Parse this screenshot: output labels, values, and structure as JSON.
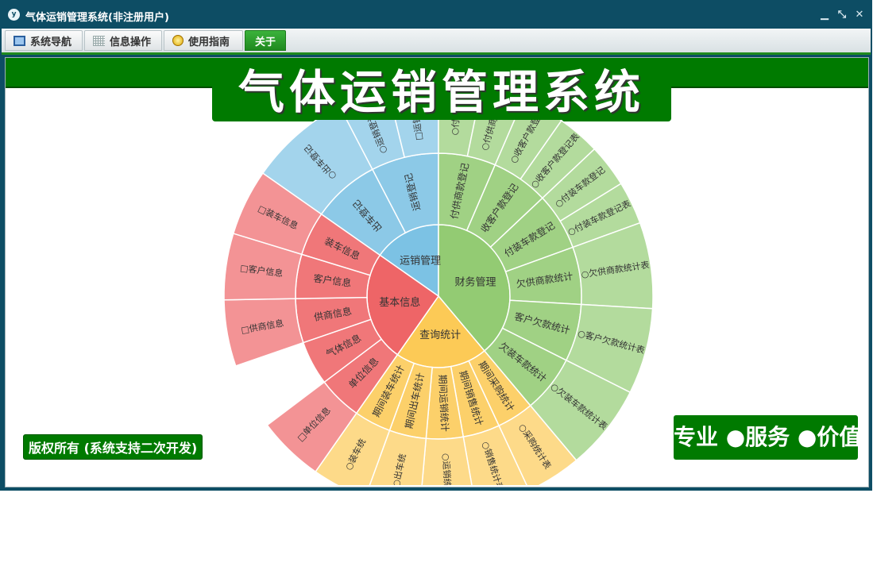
{
  "window": {
    "title": "气体运销管理系统(非注册用户)",
    "icon_name": "app-logo-icon"
  },
  "menubar": {
    "items": [
      {
        "label": "系统导航",
        "icon": "monitor-icon"
      },
      {
        "label": "信息操作",
        "icon": "grid-icon"
      },
      {
        "label": "使用指南",
        "icon": "help-disc-icon"
      },
      {
        "label": "关于",
        "icon": ""
      }
    ]
  },
  "header_banner": "气体运销管理系统",
  "copyright": "版权所有 (系统支持二次开发)",
  "slogan": "专业 ●服务 ●价值",
  "colors": {
    "window_frame": "#0d4d64",
    "banner_green": "#007a00",
    "finance": "#93cb73",
    "transport": "#7cc2e4",
    "basic": "#ee6567",
    "query": "#fcca56"
  },
  "sunburst": {
    "center_label": "",
    "sectors": [
      {
        "name": "运销管理",
        "color": "#7cc2e4",
        "children": [
          {
            "name": "出车登记",
            "children": [
              {
                "name": "○出车登记"
              }
            ]
          },
          {
            "name": "运销登记",
            "children": [
              {
                "name": "○运销登记表"
              },
              {
                "name": "□运销登记"
              }
            ]
          }
        ]
      },
      {
        "name": "财务管理",
        "color": "#93cb73",
        "children": [
          {
            "name": "付供商款登记",
            "children": [
              {
                "name": "○付供商"
              },
              {
                "name": "○付供商款记"
              }
            ]
          },
          {
            "name": "收客户款登记",
            "children": [
              {
                "name": "○收客户款登"
              },
              {
                "name": "○收客户款登记表"
              }
            ]
          },
          {
            "name": "付装车款登记",
            "children": [
              {
                "name": "○付装车款登记"
              },
              {
                "name": "○付装车款登记表"
              }
            ]
          },
          {
            "name": "欠供商款统计",
            "children": [
              {
                "name": "○欠供商款统计表"
              }
            ]
          },
          {
            "name": "客户欠款统计",
            "children": [
              {
                "name": "○客户欠款统计表"
              }
            ]
          },
          {
            "name": "欠装车款统计",
            "children": [
              {
                "name": "○欠装车款统计表"
              }
            ]
          }
        ]
      },
      {
        "name": "查询统计",
        "color": "#fcca56",
        "children": [
          {
            "name": "期间采购统计",
            "children": [
              {
                "name": "○采购统计表"
              }
            ]
          },
          {
            "name": "期间销售统计",
            "children": [
              {
                "name": "○销售统计表"
              }
            ]
          },
          {
            "name": "期间运销统计",
            "children": [
              {
                "name": "○运销统计"
              }
            ]
          },
          {
            "name": "期间出车统计",
            "children": [
              {
                "name": "○出车统"
              }
            ]
          },
          {
            "name": "期间装车统计",
            "children": [
              {
                "name": "○装车统"
              }
            ]
          }
        ]
      },
      {
        "name": "基本信息",
        "color": "#ee6567",
        "children": [
          {
            "name": "单位信息",
            "children": [
              {
                "name": "□单位信息"
              }
            ]
          },
          {
            "name": "气体信息",
            "children": []
          },
          {
            "name": "供商信息",
            "children": [
              {
                "name": "□供商信息"
              }
            ]
          },
          {
            "name": "客户信息",
            "children": [
              {
                "name": "□客户信息"
              }
            ]
          },
          {
            "name": "装车信息",
            "children": [
              {
                "name": "□装车信息"
              }
            ]
          }
        ]
      }
    ]
  }
}
